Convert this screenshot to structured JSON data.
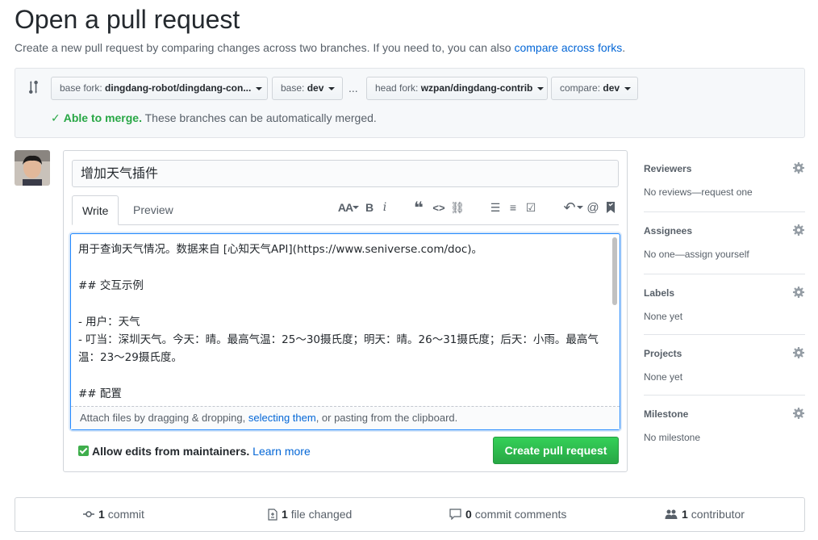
{
  "header": {
    "title": "Open a pull request",
    "subtitle": "Create a new pull request by comparing changes across two branches. If you need to, you can also ",
    "subtitle_link": "compare across forks",
    "subtitle_end": "."
  },
  "range": {
    "base_fork_label": "base fork:",
    "base_fork_value": "dingdang-robot/dingdang-con...",
    "base_label": "base:",
    "base_value": "dev",
    "ellipsis": "...",
    "head_fork_label": "head fork:",
    "head_fork_value": "wzpan/dingdang-contrib",
    "compare_label": "compare:",
    "compare_value": "dev",
    "merge_ok": "Able to merge.",
    "merge_text": " These branches can be automatically merged."
  },
  "compose": {
    "title_value": "增加天气插件",
    "tab_write": "Write",
    "tab_preview": "Preview",
    "toolbar": {
      "header": "AA",
      "bold": "B",
      "italic": "i",
      "quote": "❝",
      "code": "<>",
      "link": "⛓",
      "ul": "☰",
      "ol": "≡",
      "task": "☑",
      "reply": "↶",
      "mention": "@",
      "bookmark": "🔖"
    },
    "body_text": "用于查询天气情况。数据来自 [心知天气API](https://www.seniverse.com/doc)。\n\n## 交互示例\n\n- 用户：天气\n- 叮当：深圳天气。今天：晴。最高气温：25～30摄氏度；明天：晴。26～31摄氏度；后天：小雨。最高气温：23～29摄氏度。\n\n## 配置",
    "attach_pre": "Attach files by dragging & dropping, ",
    "attach_link": "selecting them",
    "attach_post": ", or pasting from the clipboard.",
    "maint_label": "Allow edits from maintainers.",
    "maint_link": "Learn more",
    "create_button": "Create pull request"
  },
  "sidebar": {
    "reviewers": {
      "title": "Reviewers",
      "value": "No reviews—request one"
    },
    "assignees": {
      "title": "Assignees",
      "value": "No one—assign yourself"
    },
    "labels": {
      "title": "Labels",
      "value": "None yet"
    },
    "projects": {
      "title": "Projects",
      "value": "None yet"
    },
    "milestone": {
      "title": "Milestone",
      "value": "No milestone"
    }
  },
  "summary": {
    "commits_count": "1",
    "commits_label": "commit",
    "files_count": "1",
    "files_label": "file changed",
    "comments_count": "0",
    "comments_label": "commit comments",
    "contrib_count": "1",
    "contrib_label": "contributor"
  },
  "colors": {
    "accent": "#0366d6",
    "success": "#28a745",
    "text": "#24292e",
    "muted": "#586069"
  }
}
